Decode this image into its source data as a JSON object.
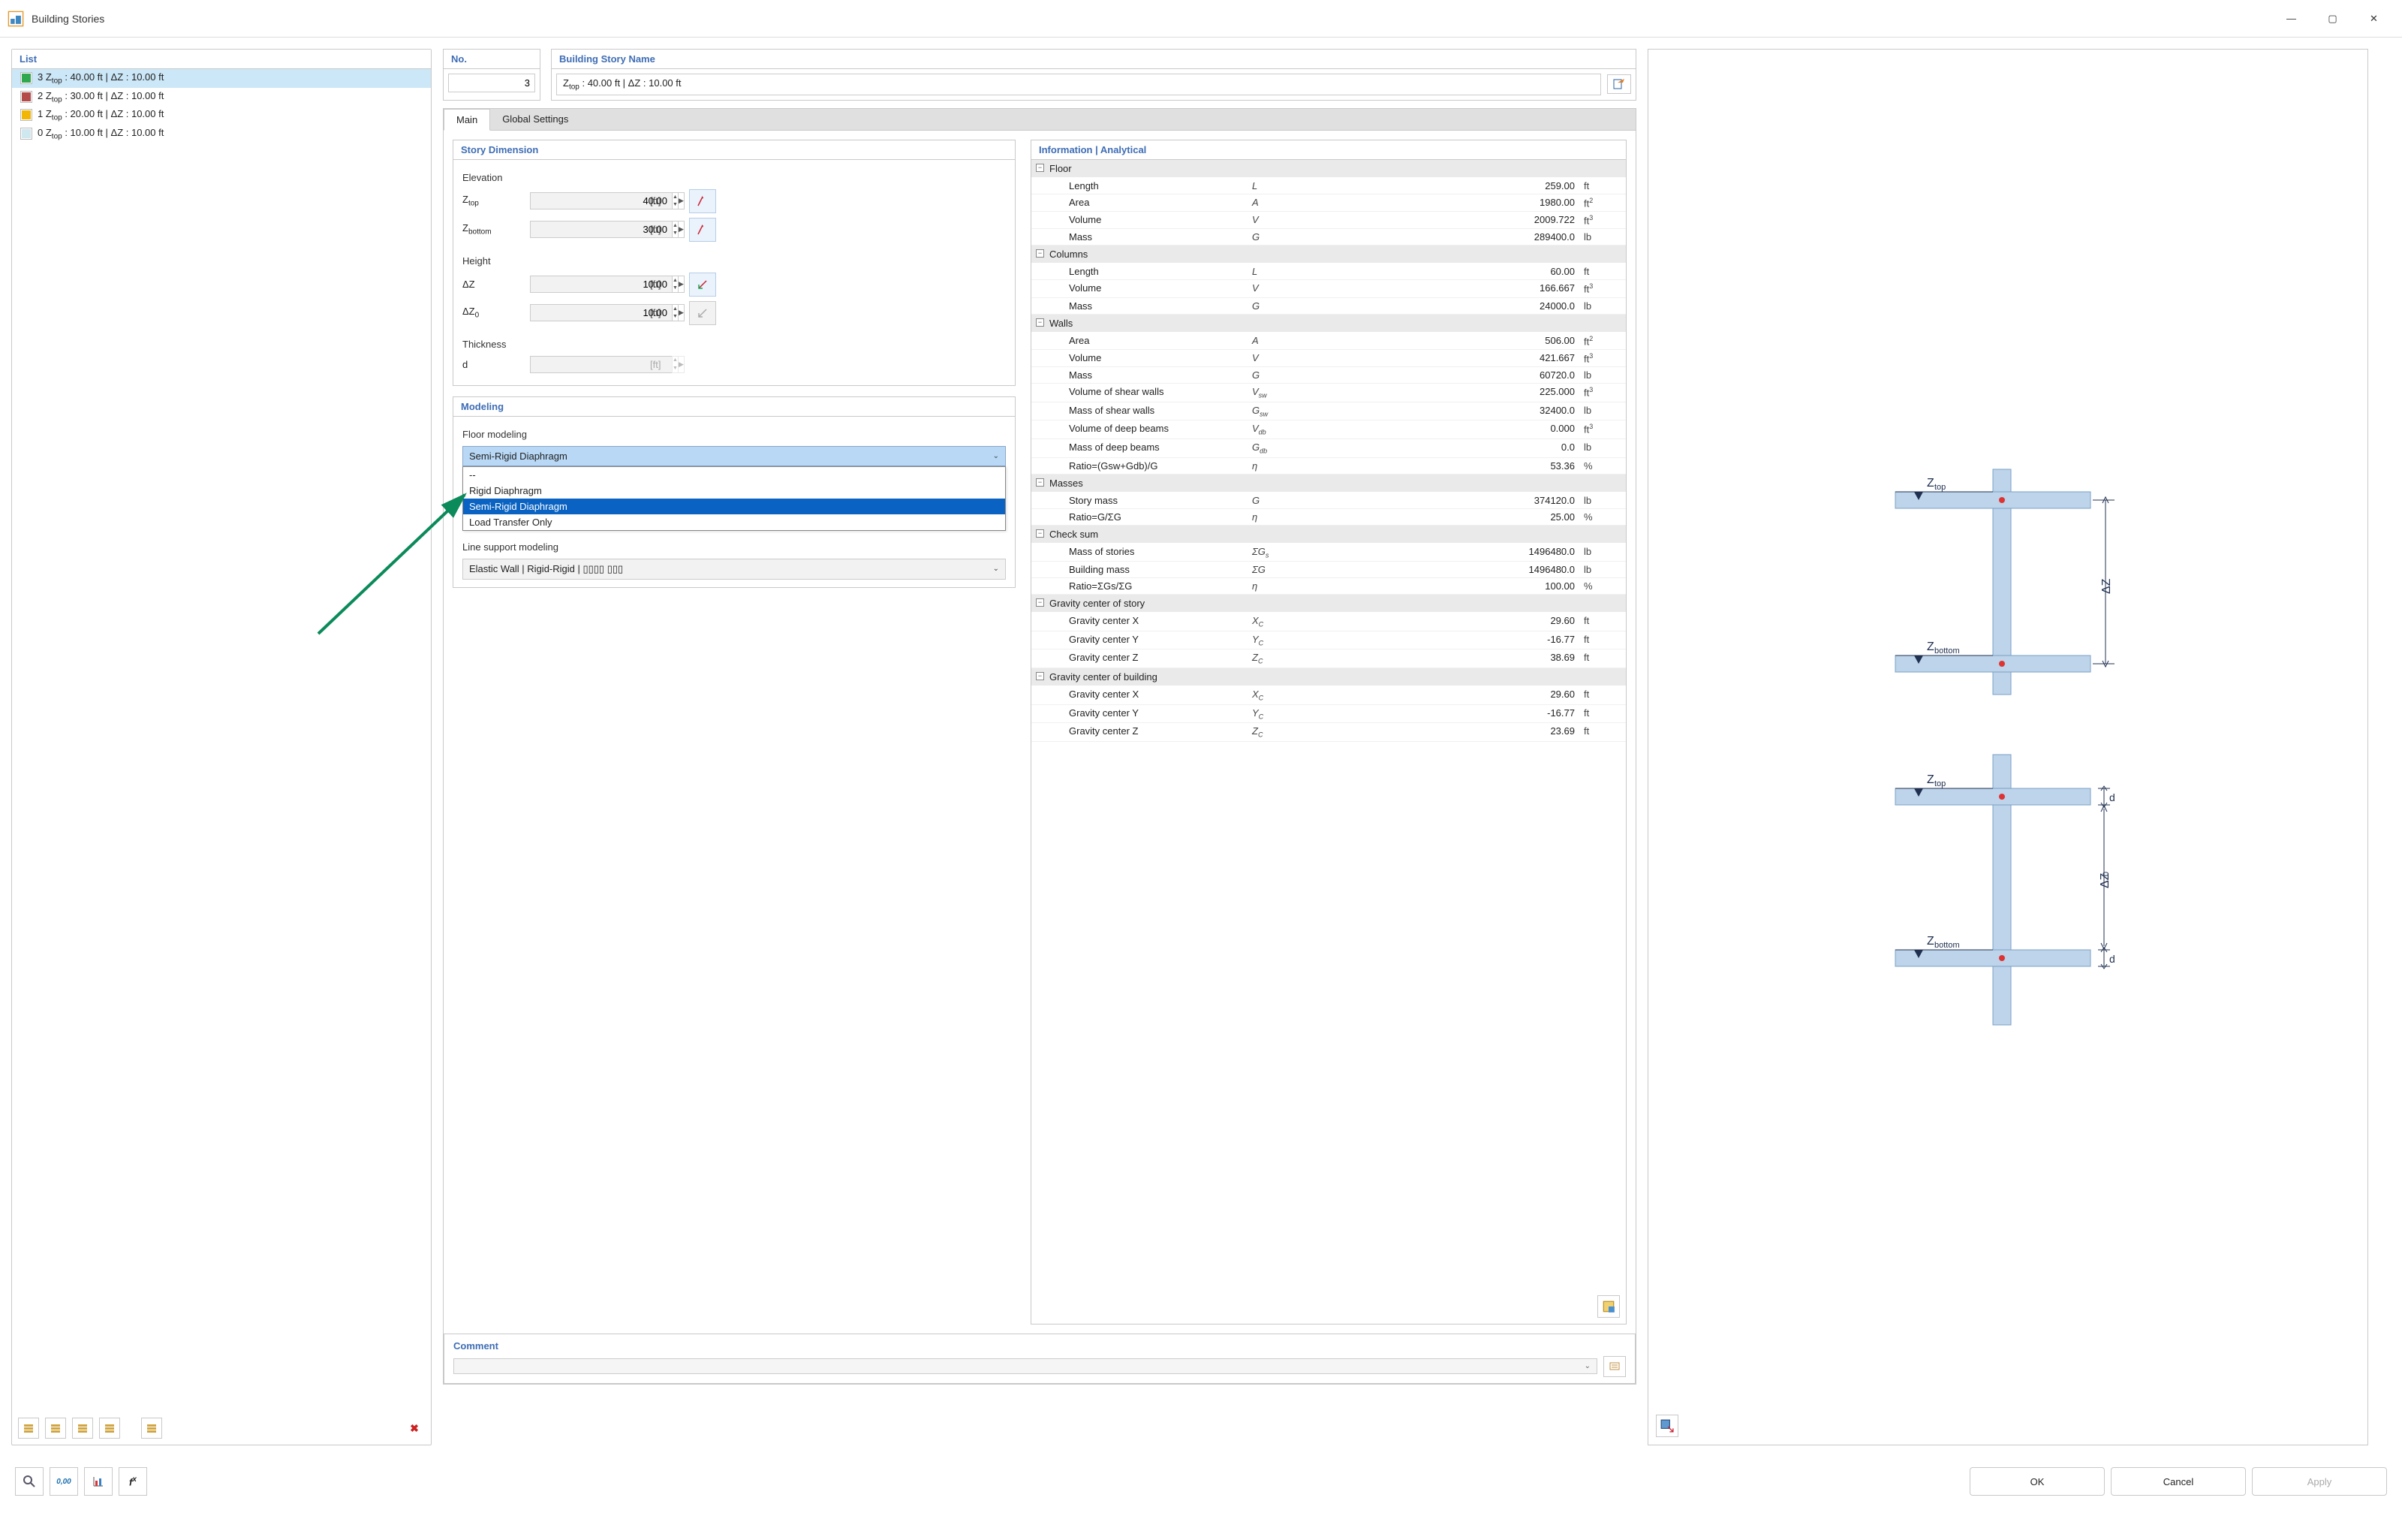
{
  "window_title": "Building Stories",
  "winbtns": {
    "minimize": "—",
    "maximize": "▢",
    "close": "✕"
  },
  "list": {
    "header": "List",
    "items": [
      {
        "color": "#2fa84f",
        "z_idx": "3",
        "z_val": "40.00",
        "dz_val": "10.00",
        "selected": true
      },
      {
        "color": "#b44b4b",
        "z_idx": "2",
        "z_val": "30.00",
        "dz_val": "10.00",
        "selected": false
      },
      {
        "color": "#f2b705",
        "z_idx": "1",
        "z_val": "20.00",
        "dz_val": "10.00",
        "selected": false
      },
      {
        "color": "#cfe7ef",
        "z_idx": "0",
        "z_val": "10.00",
        "dz_val": "10.00",
        "selected": false
      }
    ],
    "delete_icon": "✖"
  },
  "no_box": {
    "header": "No.",
    "value": "3"
  },
  "name_box": {
    "header": "Building Story Name",
    "value": "Ztop : 40.00 ft | ΔZ : 10.00 ft"
  },
  "tabs": {
    "main": "Main",
    "global": "Global Settings"
  },
  "story_dim": {
    "header": "Story Dimension",
    "elev_label": "Elevation",
    "ztop_lbl": "Z",
    "ztop_sub": "top",
    "ztop_val": "40.00",
    "unit": "[ft]",
    "zbot_lbl": "Z",
    "zbot_sub": "bottom",
    "zbot_val": "30.00",
    "height_label": "Height",
    "dz_lbl": "ΔZ",
    "dz_val": "10.00",
    "dz0_lbl": "ΔZ",
    "dz0_sub": "0",
    "dz0_val": "10.00",
    "thick_label": "Thickness",
    "d_lbl": "d"
  },
  "modeling": {
    "header": "Modeling",
    "floor_lbl": "Floor modeling",
    "floor_selected": "Semi-Rigid Diaphragm",
    "floor_opts": [
      "--",
      "Rigid Diaphragm",
      "Semi-Rigid Diaphragm",
      "Load Transfer Only"
    ],
    "floor_opt_selected_index": 2,
    "lines_lbl": "Line support modeling",
    "lines_selected": "Elastic Wall | Rigid-Rigid | ▯▯▯▯ ▯▯▯"
  },
  "info": {
    "header": "Information | Analytical",
    "sections": [
      {
        "title": "Floor",
        "rows": [
          {
            "name": "Length",
            "sym": "L",
            "val": "259.00",
            "unit": "ft"
          },
          {
            "name": "Area",
            "sym": "A",
            "val": "1980.00",
            "unit": "ft²"
          },
          {
            "name": "Volume",
            "sym": "V",
            "val": "2009.722",
            "unit": "ft³"
          },
          {
            "name": "Mass",
            "sym": "G",
            "val": "289400.0",
            "unit": "lb"
          }
        ]
      },
      {
        "title": "Columns",
        "rows": [
          {
            "name": "Length",
            "sym": "L",
            "val": "60.00",
            "unit": "ft"
          },
          {
            "name": "Volume",
            "sym": "V",
            "val": "166.667",
            "unit": "ft³"
          },
          {
            "name": "Mass",
            "sym": "G",
            "val": "24000.0",
            "unit": "lb"
          }
        ]
      },
      {
        "title": "Walls",
        "rows": [
          {
            "name": "Area",
            "sym": "A",
            "val": "506.00",
            "unit": "ft²"
          },
          {
            "name": "Volume",
            "sym": "V",
            "val": "421.667",
            "unit": "ft³"
          },
          {
            "name": "Mass",
            "sym": "G",
            "val": "60720.0",
            "unit": "lb"
          },
          {
            "name": "Volume of shear walls",
            "sym": "V",
            "sub": "sw",
            "val": "225.000",
            "unit": "ft³"
          },
          {
            "name": "Mass of shear walls",
            "sym": "G",
            "sub": "sw",
            "val": "32400.0",
            "unit": "lb"
          },
          {
            "name": "Volume of deep beams",
            "sym": "V",
            "sub": "db",
            "val": "0.000",
            "unit": "ft³"
          },
          {
            "name": "Mass of deep beams",
            "sym": "G",
            "sub": "db",
            "val": "0.0",
            "unit": "lb"
          },
          {
            "name": "Ratio=(Gsw+Gdb)/G",
            "sym": "η",
            "val": "53.36",
            "unit": "%"
          }
        ]
      },
      {
        "title": "Masses",
        "rows": [
          {
            "name": "Story mass",
            "sym": "G",
            "val": "374120.0",
            "unit": "lb"
          },
          {
            "name": "Ratio=G/ΣG",
            "sym": "η",
            "val": "25.00",
            "unit": "%"
          }
        ]
      },
      {
        "title": "Check sum",
        "rows": [
          {
            "name": "Mass of stories",
            "sym": "ΣG",
            "sub": "s",
            "val": "1496480.0",
            "unit": "lb"
          },
          {
            "name": "Building mass",
            "sym": "ΣG",
            "val": "1496480.0",
            "unit": "lb"
          },
          {
            "name": "Ratio=ΣGs/ΣG",
            "sym": "η",
            "val": "100.00",
            "unit": "%"
          }
        ]
      },
      {
        "title": "Gravity center of story",
        "rows": [
          {
            "name": "Gravity center X",
            "sym": "X",
            "sub": "C",
            "val": "29.60",
            "unit": "ft"
          },
          {
            "name": "Gravity center Y",
            "sym": "Y",
            "sub": "C",
            "val": "-16.77",
            "unit": "ft"
          },
          {
            "name": "Gravity center Z",
            "sym": "Z",
            "sub": "C",
            "val": "38.69",
            "unit": "ft"
          }
        ]
      },
      {
        "title": "Gravity center of building",
        "rows": [
          {
            "name": "Gravity center X",
            "sym": "X",
            "sub": "C",
            "val": "29.60",
            "unit": "ft"
          },
          {
            "name": "Gravity center Y",
            "sym": "Y",
            "sub": "C",
            "val": "-16.77",
            "unit": "ft"
          },
          {
            "name": "Gravity center Z",
            "sym": "Z",
            "sub": "C",
            "val": "23.69",
            "unit": "ft"
          }
        ]
      }
    ]
  },
  "comment": {
    "header": "Comment",
    "value": ""
  },
  "footer": {
    "ok": "OK",
    "cancel": "Cancel",
    "apply": "Apply"
  }
}
